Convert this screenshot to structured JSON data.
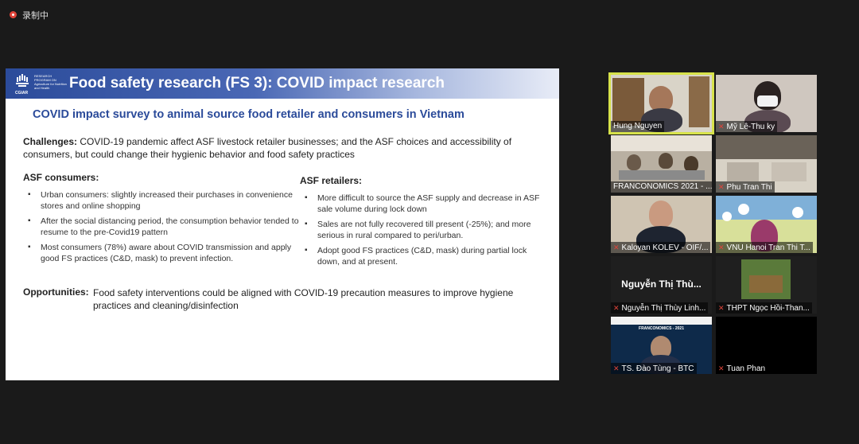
{
  "recording": {
    "label": "录制中"
  },
  "slide": {
    "logo": {
      "text": "RESEARCH PROGRAM ON Agriculture for Nutrition and Health",
      "org": "CGIAR",
      "sub": "Led by IFPRI"
    },
    "title": "Food safety research (FS 3): COVID impact research",
    "subtitle": "COVID impact survey to animal source food retailer and consumers in Vietnam",
    "challenges": {
      "label": "Challenges:",
      "text": "COVID-19 pandemic affect ASF livestock retailer businesses; and the ASF choices and accessibility of consumers, but could change their hygienic behavior and food safety practices"
    },
    "consumers": {
      "heading": "ASF consumers:",
      "items": [
        "Urban consumers: slightly increased their purchases in convenience stores and online shopping",
        "After the social distancing period, the consumption behavior tended to resume to the pre-Covid19 pattern",
        "Most consumers (78%) aware about COVID transmission and apply good FS practices (C&D, mask) to prevent infection."
      ]
    },
    "retailers": {
      "heading": "ASF retailers:",
      "items": [
        "More difficult to source the ASF supply and decrease in ASF sale volume during lock down",
        "Sales are not fully recovered till present (-25%); and more serious in rural compared to peri/urban.",
        "Adopt good FS practices (C&D, mask) during partial lock down, and at present."
      ]
    },
    "opportunities": {
      "label": "Opportunities:",
      "text": "Food safety interventions could be aligned with COVID-19 precaution measures to improve hygiene practices and cleaning/disinfection"
    }
  },
  "participants": [
    {
      "name": "Hung Nguyen",
      "muted": false,
      "active": true
    },
    {
      "name": "Mỹ Lê-Thu ky",
      "muted": true,
      "active": false
    },
    {
      "name": "FRANCONOMICS 2021 - ...",
      "muted": false,
      "active": false
    },
    {
      "name": "Phu Tran Thi",
      "muted": true,
      "active": false
    },
    {
      "name": "Kaloyan KOLEV - OIF/...",
      "muted": true,
      "active": false
    },
    {
      "name": "VNU Hanoi Tran Thi T...",
      "muted": true,
      "active": false
    },
    {
      "name": "Nguyễn Thị Thùy Linh...",
      "muted": true,
      "active": false,
      "big_name": "Nguyễn Thị Thù..."
    },
    {
      "name": "THPT Ngọc Hồi-Than...",
      "muted": true,
      "active": false
    },
    {
      "name": "TS. Đào Tùng - BTC",
      "muted": true,
      "active": false,
      "screen_title": "FRANCONOMICS - 2021"
    },
    {
      "name": "Tuan Phan",
      "muted": true,
      "active": false
    }
  ],
  "colors": {
    "accent_blue": "#2b4b9a",
    "active_border": "#d7e24a",
    "muted_red": "#e0443a"
  }
}
